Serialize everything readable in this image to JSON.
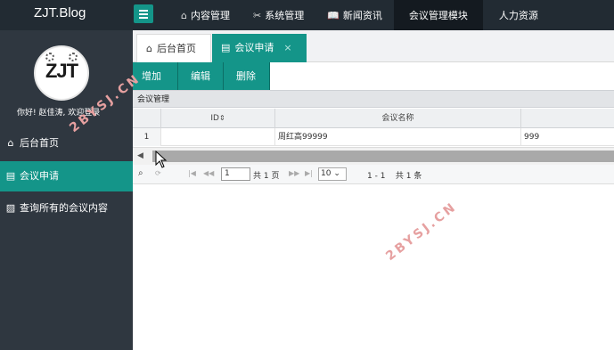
{
  "brand": "ZJT.Blog",
  "nav": [
    {
      "label": "内容管理",
      "icon": "home-icon",
      "active": false
    },
    {
      "label": "系统管理",
      "icon": "tools-icon",
      "active": false
    },
    {
      "label": "新闻资讯",
      "icon": "book-icon",
      "active": false
    },
    {
      "label": "会议管理模块",
      "icon": "",
      "active": true
    },
    {
      "label": "人力资源",
      "icon": "",
      "active": false
    }
  ],
  "avatar_text": "ZJT",
  "welcome": "你好! 赵佳涛, 欢迎登录",
  "sidebar": [
    {
      "label": "后台首页",
      "icon": "home-icon"
    },
    {
      "label": "会议申请",
      "icon": "doc-icon"
    },
    {
      "label": "查询所有的会议内容",
      "icon": "search-doc-icon"
    }
  ],
  "tabs": {
    "home": "后台首页",
    "current": "会议申请",
    "close": "×"
  },
  "toolbar": {
    "add": "增加",
    "edit": "编辑",
    "delete": "删除"
  },
  "panel_title": "会议管理",
  "grid": {
    "col_id": "ID",
    "col_name": "会议名称",
    "sort_mark": "⇕",
    "rows": [
      {
        "num": "1",
        "id": "",
        "name": "周红高99999",
        "extra": "999"
      }
    ]
  },
  "pager": {
    "page": "1",
    "total_pages": "共 1 页",
    "page_size": "10",
    "summary": "1 - 1    共 1 条"
  },
  "watermark": "2BYSJ.CN"
}
